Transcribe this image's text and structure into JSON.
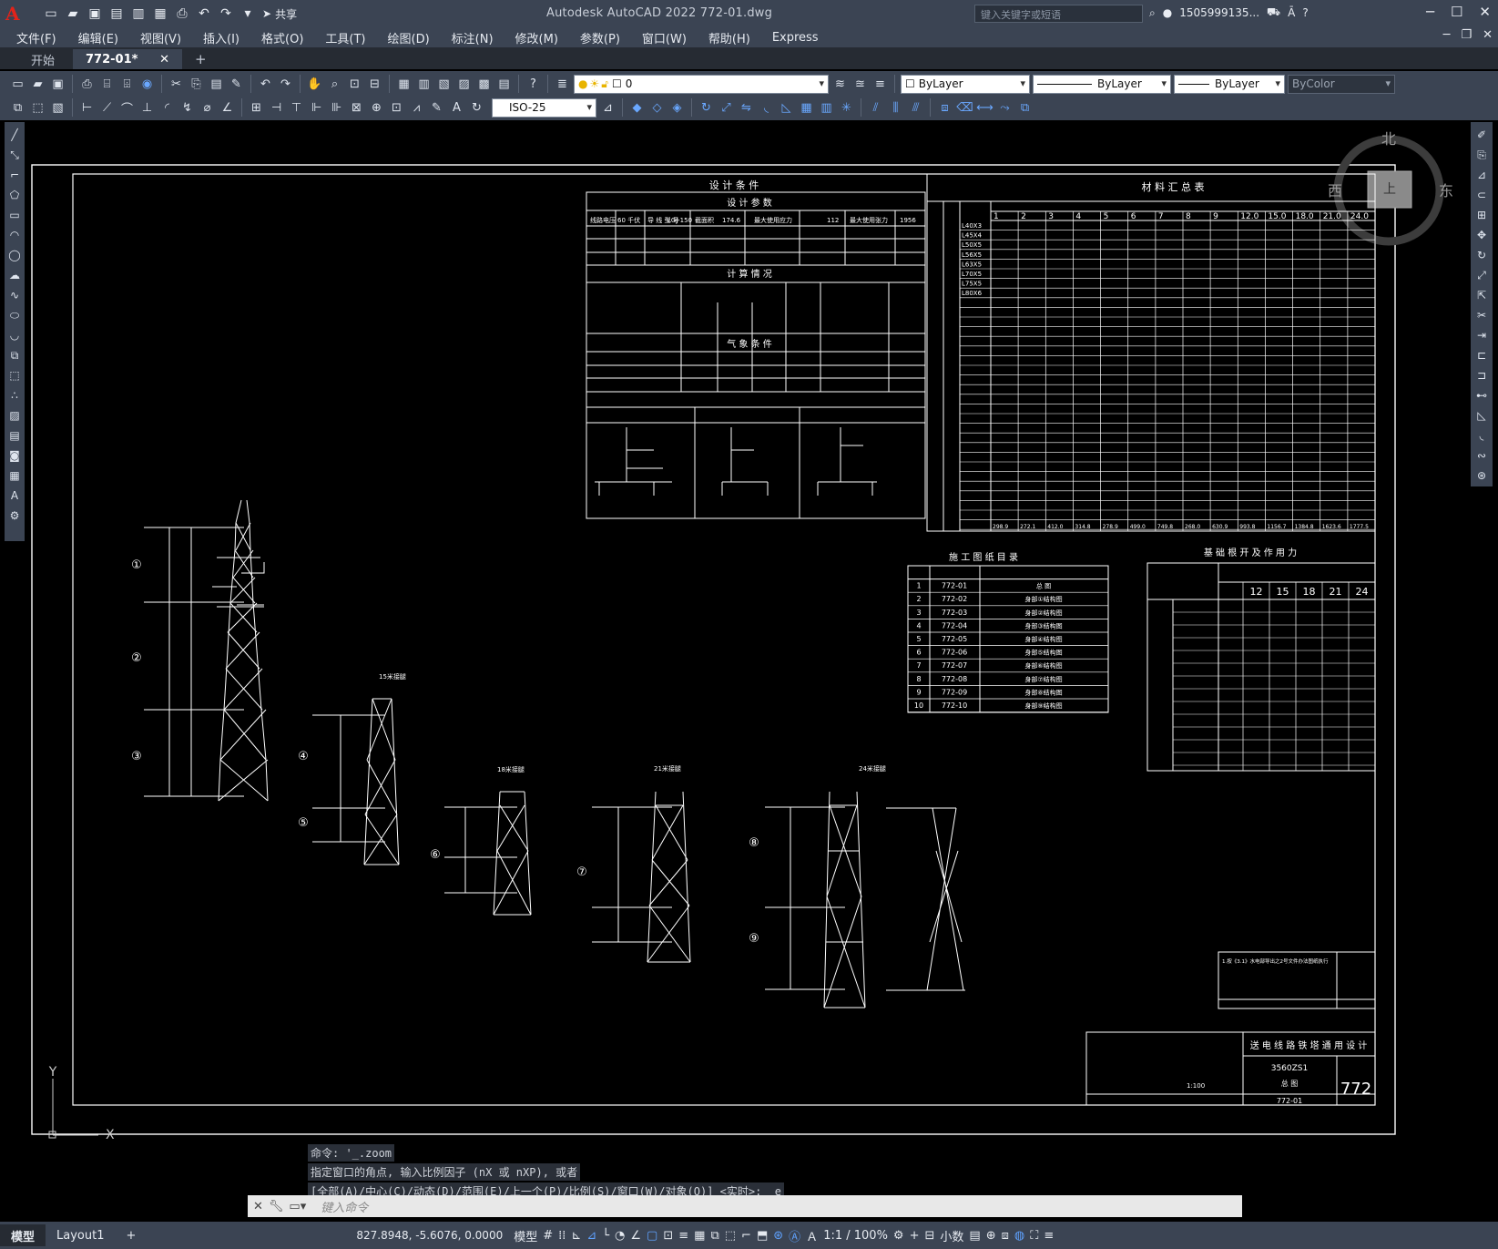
{
  "app": {
    "window_title": "Autodesk AutoCAD 2022    772-01.dwg",
    "share_label": "共享",
    "search_placeholder": "键入关键字或短语",
    "user": "1505999135...",
    "colors": {
      "chrome": "#3b4453",
      "canvas": "#000000",
      "line": "#ffffff"
    }
  },
  "menu": [
    "文件(F)",
    "编辑(E)",
    "视图(V)",
    "插入(I)",
    "格式(O)",
    "工具(T)",
    "绘图(D)",
    "标注(N)",
    "修改(M)",
    "参数(P)",
    "窗口(W)",
    "帮助(H)",
    "Express"
  ],
  "tabs": {
    "start": "开始",
    "doc": "772-01*"
  },
  "props": {
    "layer": "0",
    "color": "ByLayer",
    "linetype": "ByLayer",
    "lineweight": "ByLayer",
    "plotstyle": "ByColor",
    "dimstyle": "ISO-25"
  },
  "viewcube": {
    "north": "北",
    "south": "南",
    "east": "东",
    "west": "西",
    "face": "上"
  },
  "ucs": {
    "x": "X",
    "y": "Y"
  },
  "drawing": {
    "design_conditions": "设 计 条 件",
    "design_params": "设 计 参 数",
    "calc_conditions": "计 算 情 况",
    "weather": "气 象 条 件",
    "material_summary": "材 料 汇 总 表",
    "drawing_list": "施 工 图 纸 目 录",
    "foundation": "基 础 根 开 及 作 用 力",
    "title_block_title": "送 电 线 路 铁 塔 通 用 设 计",
    "tower_code": "3560ZS1",
    "sheet_name": "总 图",
    "drawing_no": "772-01",
    "sheet_big": "772",
    "scale": "1:100",
    "params_row": [
      "线路电压",
      "60 千伏",
      "导 线 型 号",
      "LGJ-150",
      "截面积",
      "174.6",
      "最大使用应力",
      "112",
      "最大使用张力",
      "1956"
    ],
    "tower_labels": [
      "①",
      "②",
      "③",
      "④",
      "⑤",
      "⑥",
      "⑦",
      "⑧",
      "⑨"
    ],
    "section_titles": [
      "15米接腿",
      "18米接腿",
      "21米接腿",
      "24米接腿"
    ],
    "drawing_list_rows": [
      [
        "1",
        "772-01",
        "总 图"
      ],
      [
        "2",
        "772-02",
        "身部①结构图"
      ],
      [
        "3",
        "772-03",
        "身部②结构图"
      ],
      [
        "4",
        "772-04",
        "身部③结构图"
      ],
      [
        "5",
        "772-05",
        "身部④结构图"
      ],
      [
        "6",
        "772-06",
        "身部⑤结构图"
      ],
      [
        "7",
        "772-07",
        "身部⑥结构图"
      ],
      [
        "8",
        "772-08",
        "身部⑦结构图"
      ],
      [
        "9",
        "772-09",
        "身部⑧结构图"
      ],
      [
        "10",
        "772-10",
        "身部⑨结构图"
      ]
    ],
    "foundation_heights": [
      "12",
      "15",
      "18",
      "21",
      "24"
    ],
    "material_cols": [
      "1",
      "2",
      "3",
      "4",
      "5",
      "6",
      "7",
      "8",
      "9",
      "12.0",
      "15.0",
      "18.0",
      "21.0",
      "24.0"
    ],
    "material_rows": [
      "L40X3",
      "L45X4",
      "L50X5",
      "L56X5",
      "L63X5",
      "L70X5",
      "L75X5",
      "L80X6"
    ],
    "weights": [
      "298.9",
      "272.1",
      "412.0",
      "314.8",
      "278.9",
      "499.0",
      "749.8",
      "268.0",
      "630.9",
      "993.8",
      "1156.7",
      "1384.8",
      "1623.6",
      "1777.5"
    ],
    "note": "1.按《3.1》水电部导出之2号文件办法图纸执行"
  },
  "command": {
    "history": [
      "命令: '_.zoom",
      "指定窗口的角点, 输入比例因子 (nX 或 nXP), 或者",
      "[全部(A)/中心(C)/动态(D)/范围(E)/上一个(P)/比例(S)/窗口(W)/对象(O)] <实时>: _e"
    ],
    "placeholder": "键入命令"
  },
  "status": {
    "model_tab": "模型",
    "layout_tab": "Layout1",
    "coords": "827.8948, -5.6076, 0.0000",
    "space": "模型",
    "scale": "1:1 / 100%",
    "units": "小数"
  }
}
